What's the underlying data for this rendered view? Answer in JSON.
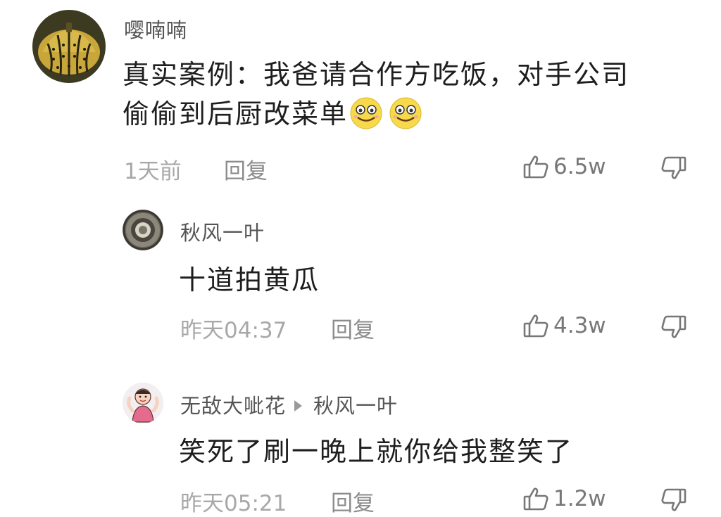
{
  "comments": [
    {
      "user": "嘤喃喃",
      "content_line1": "真实案例：我爸请合作方吃饭，对手公司",
      "content_line2": "偷偷到后厨改菜单",
      "time": "1天前",
      "reply_label": "回复",
      "likes": "6.5w",
      "avatar_icon": "pumpkin-avatar-icon"
    },
    {
      "user": "秋风一叶",
      "content": "十道拍黄瓜",
      "time": "昨天04:37",
      "reply_label": "回复",
      "likes": "4.3w",
      "avatar_icon": "ring-avatar-icon"
    },
    {
      "user": "无敌大呲花",
      "reply_to": "秋风一叶",
      "content": "笑死了刷一晚上就你给我整笑了",
      "time": "昨天05:21",
      "reply_label": "回复",
      "likes": "1.2w",
      "avatar_icon": "cartoon-avatar-icon"
    }
  ],
  "colors": {
    "text": "#1e1e1e",
    "username": "#555555",
    "meta": "#a8a8a8",
    "icon": "#777777"
  }
}
